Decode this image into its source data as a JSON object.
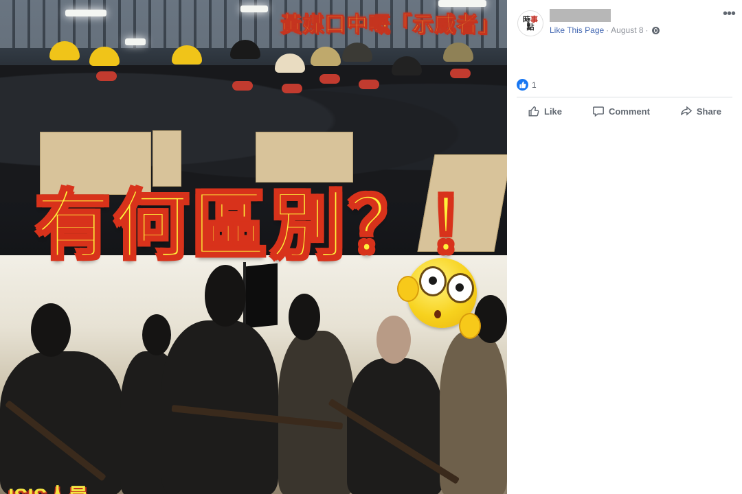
{
  "post_image": {
    "caption_top": "黃媒口中嘅「示威者」",
    "headline": "有何區別？！",
    "caption_bottom": "ISIS人員"
  },
  "page": {
    "avatar_logo_lines": [
      "時",
      "事",
      "點"
    ],
    "like_page_label": "Like This Page",
    "separator": "·",
    "date": "August 8",
    "privacy_icon": "globe-icon",
    "more_icon": "more-icon"
  },
  "reactions": {
    "like_icon": "thumbs-up-icon",
    "count": "1"
  },
  "actions": {
    "like_label": "Like",
    "comment_label": "Comment",
    "share_label": "Share"
  },
  "colors": {
    "brand_blue": "#4267b2",
    "like_blue": "#1877f2",
    "meta_gray": "#90949c",
    "action_gray": "#606770",
    "caption_yellow": "#f5e542",
    "caption_red": "#d8321b"
  }
}
